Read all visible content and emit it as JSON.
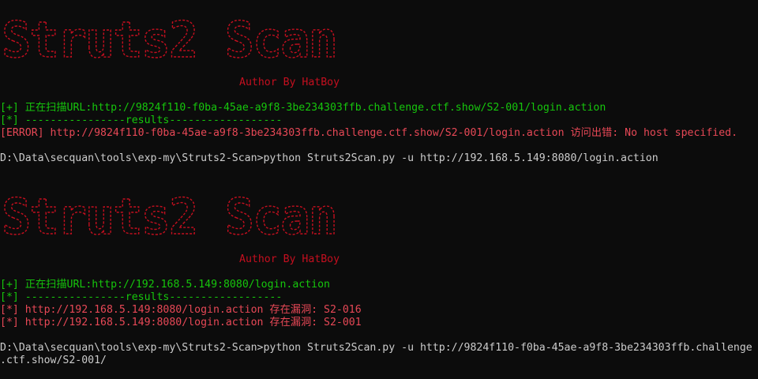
{
  "banner": {
    "text": "Struts2 Scan",
    "author": "Author By HatBoy"
  },
  "colors": {
    "background": "#0c0c0c",
    "banner_red": "#c50f1f",
    "error_red": "#e74856",
    "green": "#16c60c",
    "white": "#cccccc"
  },
  "run1": {
    "scan_line": "[+] 正在扫描URL:http://9824f110-f0ba-45ae-a9f8-3be234303ffb.challenge.ctf.show/S2-001/login.action",
    "results_line": "[*] ----------------results------------------",
    "error_line": "[ERROR] http://9824f110-f0ba-45ae-a9f8-3be234303ffb.challenge.ctf.show/S2-001/login.action 访问出错: No host specified."
  },
  "prompt1": "D:\\Data\\secquan\\tools\\exp-my\\Struts2-Scan>python Struts2Scan.py -u http://192.168.5.149:8080/login.action",
  "run2": {
    "scan_line": "[+] 正在扫描URL:http://192.168.5.149:8080/login.action",
    "results_line": "[*] ----------------results------------------",
    "vuln_lines": [
      "[*] http://192.168.5.149:8080/login.action 存在漏洞: S2-016",
      "[*] http://192.168.5.149:8080/login.action 存在漏洞: S2-001"
    ]
  },
  "prompt2": {
    "line1": "D:\\Data\\secquan\\tools\\exp-my\\Struts2-Scan>python Struts2Scan.py -u http://9824f110-f0ba-45ae-a9f8-3be234303ffb.challenge",
    "line2": ".ctf.show/S2-001/"
  }
}
